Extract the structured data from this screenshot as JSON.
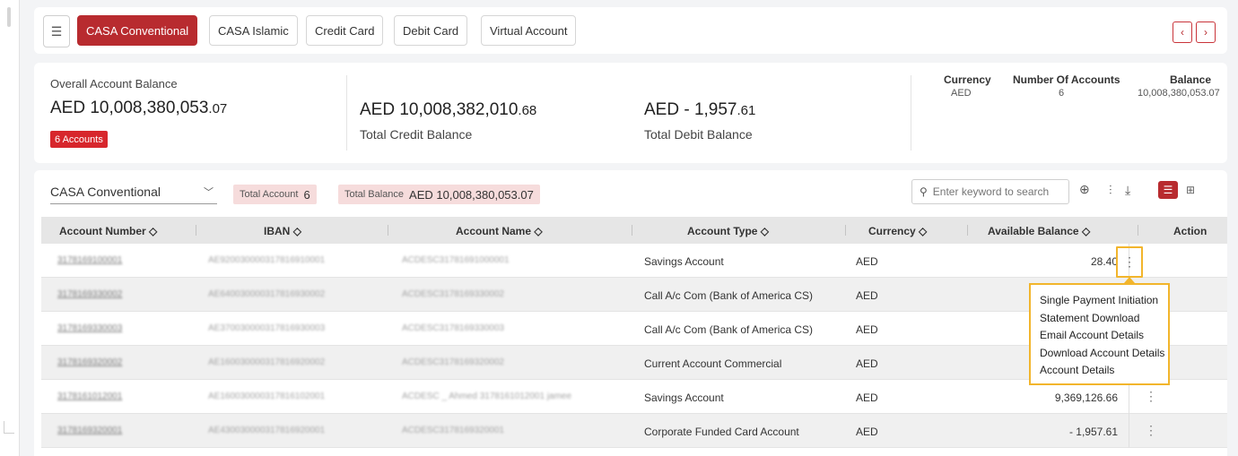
{
  "tabs": [
    {
      "label": "CASA Conventional",
      "active": true
    },
    {
      "label": "CASA Islamic",
      "active": false
    },
    {
      "label": "Credit Card",
      "active": false
    },
    {
      "label": "Debit Card",
      "active": false
    },
    {
      "label": "Virtual Account",
      "active": false
    }
  ],
  "icons": {
    "menu": "☰",
    "prev": "‹",
    "next": "›",
    "search": "⚲",
    "zoom": "⊕",
    "filter": "⫶",
    "download": "⤓",
    "list": "☰",
    "grid": "⊞",
    "kebab": "⋮",
    "sort": "◇",
    "chevron": "﹀"
  },
  "summary": {
    "overall_label": "Overall Account Balance",
    "overall_amount": "AED 10,008,380,053",
    "overall_decimals": ".07",
    "accounts_badge": "6 Accounts",
    "credit_amount": "AED 10,008,382,010",
    "credit_decimals": ".68",
    "credit_label": "Total Credit Balance",
    "debit_amount": "AED - 1,957",
    "debit_decimals": ".61",
    "debit_label": "Total Debit Balance",
    "currency_table": {
      "headers": [
        "Currency",
        "Number Of Accounts",
        "Balance"
      ],
      "row": [
        "AED",
        "6",
        "10,008,380,053.07"
      ]
    }
  },
  "filter": {
    "selected": "CASA Conventional",
    "total_account_label": "Total Account",
    "total_account_value": "6",
    "total_balance_label": "Total Balance",
    "total_balance_value": "AED 10,008,380,053.07",
    "search_placeholder": "Enter keyword to search"
  },
  "table": {
    "headers": [
      "Account Number",
      "IBAN",
      "Account Name",
      "Account Type",
      "Currency",
      "Available Balance",
      "Action"
    ],
    "rows": [
      {
        "account_number": "3178169100001",
        "iban": "AE920030000317816910001",
        "name": "ACDESC31781691000001",
        "type": "Savings Account",
        "currency": "AED",
        "balance": "28.40"
      },
      {
        "account_number": "3178169330002",
        "iban": "AE640030000317816930002",
        "name": "ACDESC3178169330002",
        "type": "Call A/c Com (Bank of America CS)",
        "currency": "AED",
        "balance": ""
      },
      {
        "account_number": "3178169330003",
        "iban": "AE370030000317816930003",
        "name": "ACDESC3178169330003",
        "type": "Call A/c Com (Bank of America CS)",
        "currency": "AED",
        "balance": ""
      },
      {
        "account_number": "3178169320002",
        "iban": "AE160030000317816920002",
        "name": "ACDESC3178169320002",
        "type": "Current Account Commercial",
        "currency": "AED",
        "balance": ""
      },
      {
        "account_number": "3178161012001",
        "iban": "AE160030000317816102001",
        "name": "ACDESC _ Ahmed 3178161012001 jamee",
        "type": "Savings Account",
        "currency": "AED",
        "balance": "9,369,126.66"
      },
      {
        "account_number": "3178169320001",
        "iban": "AE430030000317816920001",
        "name": "ACDESC3178169320001",
        "type": "Corporate Funded Card Account",
        "currency": "AED",
        "balance": "- 1,957.61"
      }
    ]
  },
  "action_menu": {
    "items": [
      "Single Payment Initiation",
      "Statement Download",
      "Email Account Details",
      "Download Account Details",
      "Account Details"
    ]
  },
  "colors": {
    "brand": "#b82b2f",
    "highlight": "#f2b52c"
  }
}
